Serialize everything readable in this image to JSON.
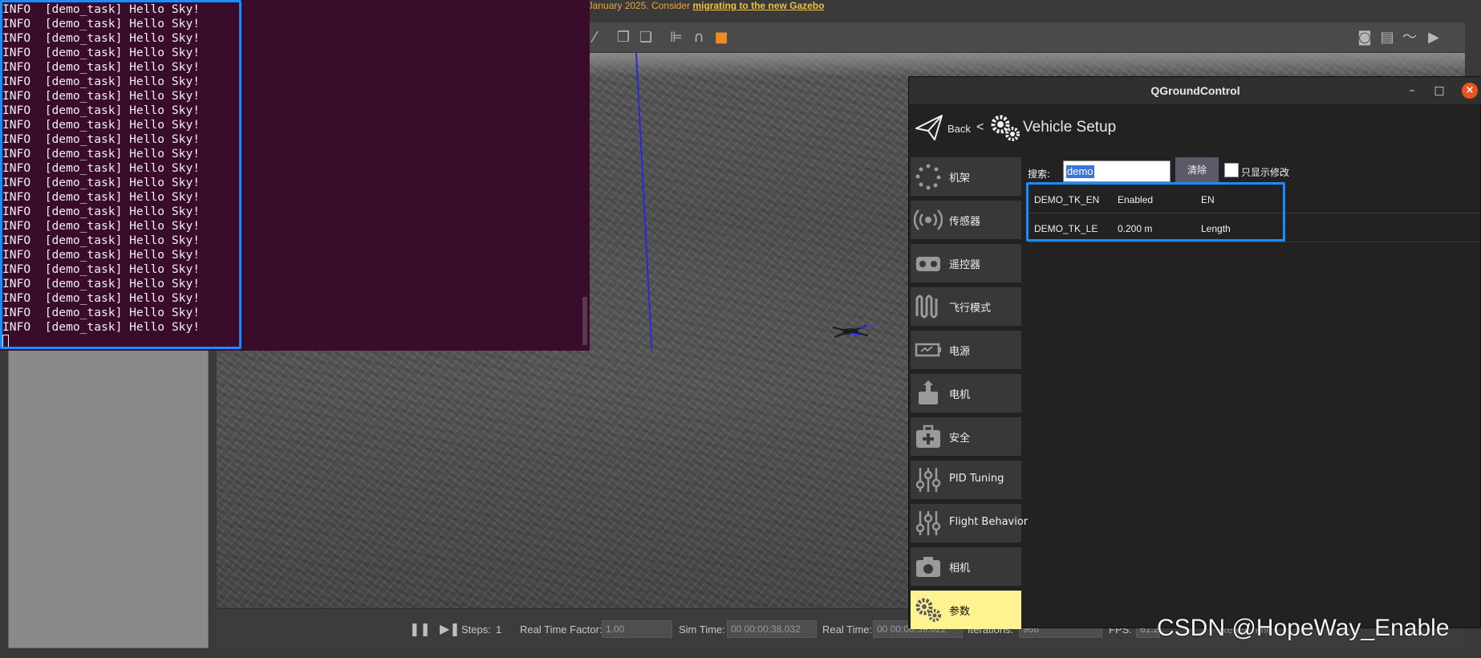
{
  "gazebo": {
    "banner_text": "in January 2025. Consider",
    "banner_link": "migrating to the new Gazebo",
    "bottom": {
      "steps_label": "Steps:",
      "steps_value": "1",
      "rtf_label": "Real Time Factor:",
      "rtf_value": "1.00",
      "simtime_label": "Sim Time:",
      "simtime_value": "00 00:00:38.032",
      "realtime_label": "Real Time:",
      "realtime_value": "00 00:00:39.022",
      "iterations_label": "Iterations:",
      "iterations_value": "966",
      "fps_label": "FPS:",
      "fps_value": "61.2",
      "reset_label": "Reset Time"
    }
  },
  "terminal": {
    "lines": [
      "INFO  [demo_task] Hello Sky!",
      "INFO  [demo_task] Hello Sky!",
      "INFO  [demo_task] Hello Sky!",
      "INFO  [demo_task] Hello Sky!",
      "INFO  [demo_task] Hello Sky!",
      "INFO  [demo_task] Hello Sky!",
      "INFO  [demo_task] Hello Sky!",
      "INFO  [demo_task] Hello Sky!",
      "INFO  [demo_task] Hello Sky!",
      "INFO  [demo_task] Hello Sky!",
      "INFO  [demo_task] Hello Sky!",
      "INFO  [demo_task] Hello Sky!",
      "INFO  [demo_task] Hello Sky!",
      "INFO  [demo_task] Hello Sky!",
      "INFO  [demo_task] Hello Sky!",
      "INFO  [demo_task] Hello Sky!",
      "INFO  [demo_task] Hello Sky!",
      "INFO  [demo_task] Hello Sky!",
      "INFO  [demo_task] Hello Sky!",
      "INFO  [demo_task] Hello Sky!",
      "INFO  [demo_task] Hello Sky!",
      "INFO  [demo_task] Hello Sky!",
      "INFO  [demo_task] Hello Sky!"
    ]
  },
  "qgc": {
    "title": "QGroundControl",
    "back_label": "Back",
    "back_sep": "<",
    "page_title": "Vehicle Setup",
    "nav": [
      {
        "label": "机架",
        "icon": "airframe-icon"
      },
      {
        "label": "传感器",
        "icon": "sensors-icon"
      },
      {
        "label": "遥控器",
        "icon": "radio-icon"
      },
      {
        "label": "飞行模式",
        "icon": "flight-modes-icon"
      },
      {
        "label": "电源",
        "icon": "power-icon"
      },
      {
        "label": "电机",
        "icon": "motors-icon"
      },
      {
        "label": "安全",
        "icon": "safety-icon"
      },
      {
        "label": "PID Tuning",
        "icon": "pid-tuning-icon"
      },
      {
        "label": "Flight Behavior",
        "icon": "flight-behavior-icon"
      },
      {
        "label": "相机",
        "icon": "camera-icon"
      },
      {
        "label": "参数",
        "icon": "parameters-icon"
      }
    ],
    "active_index": 10,
    "search": {
      "label": "搜索:",
      "value": "demo",
      "clear_label": "清除",
      "modified_only_label": "只显示修改",
      "modified_only_checked": false
    },
    "params": [
      {
        "name": "DEMO_TK_EN",
        "value": "Enabled",
        "desc": "EN"
      },
      {
        "name": "DEMO_TK_LE",
        "value": "0.200 m",
        "desc": "Length"
      }
    ]
  },
  "watermark": "CSDN @HopeWay_Enable",
  "colors": {
    "terminal_bg": "#380c2a",
    "highlight": "#1a8cff",
    "active_nav": "#fff291",
    "close_button": "#e95420"
  }
}
